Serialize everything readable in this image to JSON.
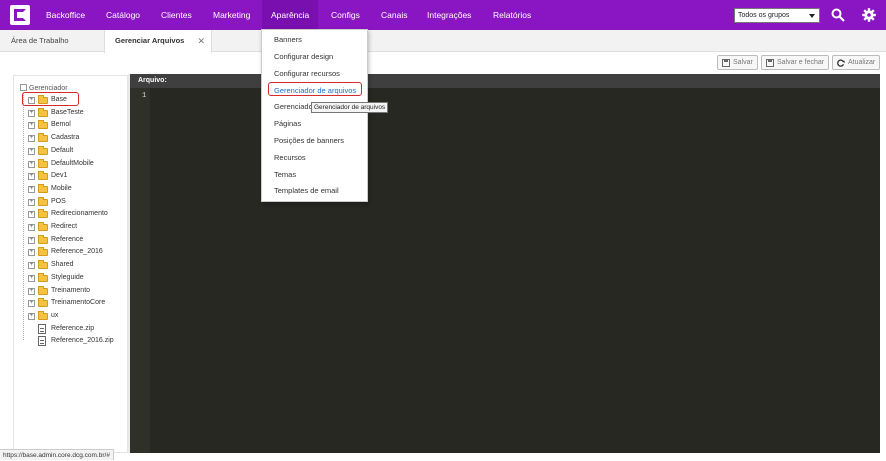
{
  "nav": {
    "items": [
      {
        "label": "Backoffice"
      },
      {
        "label": "Catálogo"
      },
      {
        "label": "Clientes"
      },
      {
        "label": "Marketing"
      },
      {
        "label": "Aparência"
      },
      {
        "label": "Configs"
      },
      {
        "label": "Canais"
      },
      {
        "label": "Integrações"
      },
      {
        "label": "Relatórios"
      }
    ],
    "active_item": "Aparência",
    "group_select_value": "Todos os grupos",
    "brand_color": "#8a15c3"
  },
  "tabs": {
    "workspace_label": "Área de Trabalho",
    "active_label": "Gerenciar Arquivos",
    "close_glyph": "✕"
  },
  "toolbar": {
    "save_label": "Salvar",
    "save_close_label": "Salvar e fechar",
    "refresh_label": "Atualizar"
  },
  "tree": {
    "root_label": "Gerenciador",
    "nodes": [
      {
        "label": "Base",
        "type": "folder"
      },
      {
        "label": "BaseTeste",
        "type": "folder"
      },
      {
        "label": "Bemol",
        "type": "folder"
      },
      {
        "label": "Cadastra",
        "type": "folder"
      },
      {
        "label": "Default",
        "type": "folder"
      },
      {
        "label": "DefaultMobile",
        "type": "folder"
      },
      {
        "label": "Dev1",
        "type": "folder"
      },
      {
        "label": "Mobile",
        "type": "folder"
      },
      {
        "label": "POS",
        "type": "folder"
      },
      {
        "label": "Redirecionamento",
        "type": "folder"
      },
      {
        "label": "Redirect",
        "type": "folder"
      },
      {
        "label": "Reference",
        "type": "folder"
      },
      {
        "label": "Reference_2016",
        "type": "folder"
      },
      {
        "label": "Shared",
        "type": "folder"
      },
      {
        "label": "Styleguide",
        "type": "folder"
      },
      {
        "label": "Treinamento",
        "type": "folder"
      },
      {
        "label": "TreinamentoCore",
        "type": "folder"
      },
      {
        "label": "ux",
        "type": "folder"
      },
      {
        "label": "Reference.zip",
        "type": "file"
      },
      {
        "label": "Reference_2016.zip",
        "type": "file"
      }
    ]
  },
  "editor": {
    "header_label": "Arquivo:",
    "line_number": "1"
  },
  "dropdown": {
    "items": [
      {
        "label": "Banners"
      },
      {
        "label": "Configurar design"
      },
      {
        "label": "Configurar recursos"
      },
      {
        "label": "Gerenciador de arquivos"
      },
      {
        "label": "Gerenciador"
      },
      {
        "label": "Páginas"
      },
      {
        "label": "Posições de banners"
      },
      {
        "label": "Recursos"
      },
      {
        "label": "Temas"
      },
      {
        "label": "Templates de email"
      }
    ],
    "tooltip": "Gerenciador de arquivos"
  },
  "status": {
    "url": "https://base.admin.core.dcg.com.br/#"
  }
}
